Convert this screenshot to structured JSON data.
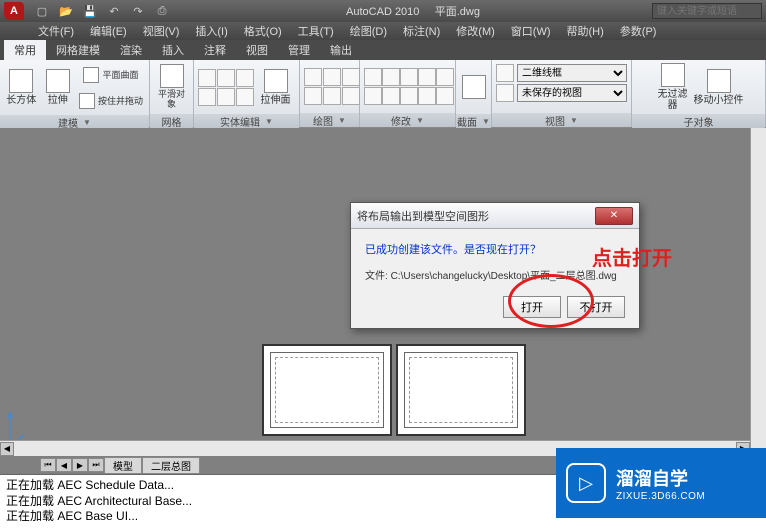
{
  "qat": {
    "title_app": "AutoCAD 2010",
    "title_file": "平面.dwg",
    "search_placeholder": "键入关键字或短语"
  },
  "menubar": [
    "文件(F)",
    "编辑(E)",
    "视图(V)",
    "插入(I)",
    "格式(O)",
    "工具(T)",
    "绘图(D)",
    "标注(N)",
    "修改(M)",
    "窗口(W)",
    "帮助(H)",
    "参数(P)"
  ],
  "ribbon_tabs": [
    "常用",
    "网格建模",
    "渲染",
    "插入",
    "注释",
    "视图",
    "管理",
    "输出"
  ],
  "ribbon_active_tab": 0,
  "panels": {
    "build": {
      "title": "建模",
      "btn1": "长方体",
      "btn2": "拉伸",
      "btn3": "平面曲面",
      "btn4": "按住并拖动"
    },
    "grid": {
      "title": "网格",
      "btn": "平滑对象"
    },
    "solid": {
      "title": "实体编辑",
      "btn": "拉伸面"
    },
    "draw": {
      "title": "绘图"
    },
    "modify": {
      "title": "修改"
    },
    "section": {
      "title": "截面"
    },
    "view": {
      "title": "视图",
      "dd1": "二维线框",
      "dd2": "未保存的视图"
    },
    "sub": {
      "title": "子对象",
      "btn1": "无过滤器",
      "btn2": "移动小控件"
    }
  },
  "dialog": {
    "title": "将布局输出到模型空间图形",
    "message": "已成功创建该文件。是否现在打开？",
    "path_label": "文件:",
    "path": "C:\\Users\\changelucky\\Desktop\\平面_二层总图.dwg",
    "btn_open": "打开",
    "btn_noopen": "不打开"
  },
  "annotation": {
    "text": "点击打开"
  },
  "layout_tabs": [
    "模型",
    "二层总图"
  ],
  "command_log": [
    "正在加载 AEC Schedule Data...",
    "正在加载 AEC Architectural Base...",
    "正在加载 AEC Base UI..."
  ],
  "watermark": {
    "brand": "溜溜自学",
    "url": "ZIXUE.3D66.COM"
  }
}
